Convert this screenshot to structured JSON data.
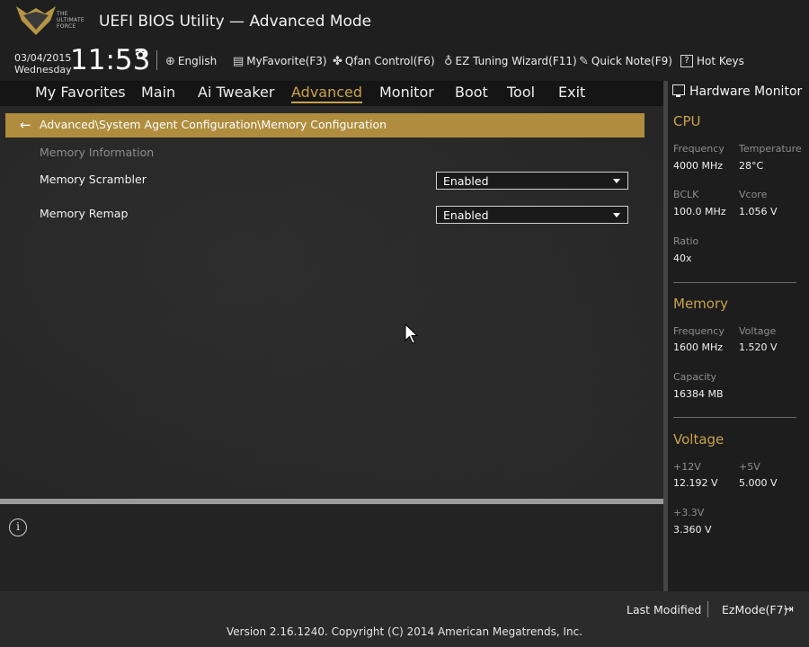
{
  "header": {
    "logo_text": "THE ULTIMATE FORCE",
    "title": "UEFI BIOS Utility — Advanced Mode",
    "date": "03/04/2015",
    "weekday": "Wednesday",
    "time": "11:53",
    "toolbar": [
      {
        "label": "English",
        "icon": "globe-icon"
      },
      {
        "label": "MyFavorite(F3)",
        "icon": "favorite-icon"
      },
      {
        "label": "Qfan Control(F6)",
        "icon": "fan-icon"
      },
      {
        "label": "EZ Tuning Wizard(F11)",
        "icon": "lightbulb-icon"
      },
      {
        "label": "Quick Note(F9)",
        "icon": "note-icon"
      },
      {
        "label": "Hot Keys",
        "icon": "question-icon"
      }
    ]
  },
  "nav": {
    "items": [
      "My Favorites",
      "Main",
      "Ai Tweaker",
      "Advanced",
      "Monitor",
      "Boot",
      "Tool",
      "Exit"
    ],
    "active": "Advanced"
  },
  "breadcrumb": "Advanced\\System Agent Configuration\\Memory Configuration",
  "main": {
    "section_label": "Memory Information",
    "rows": [
      {
        "label": "Memory Scrambler",
        "value": "Enabled"
      },
      {
        "label": "Memory Remap",
        "value": "Enabled"
      }
    ]
  },
  "hardware_monitor": {
    "title": "Hardware Monitor",
    "cpu": {
      "heading": "CPU",
      "frequency_label": "Frequency",
      "frequency": "4000 MHz",
      "temperature_label": "Temperature",
      "temperature": "28°C",
      "bclk_label": "BCLK",
      "bclk": "100.0 MHz",
      "vcore_label": "Vcore",
      "vcore": "1.056 V",
      "ratio_label": "Ratio",
      "ratio": "40x"
    },
    "memory": {
      "heading": "Memory",
      "frequency_label": "Frequency",
      "frequency": "1600 MHz",
      "voltage_label": "Voltage",
      "voltage": "1.520 V",
      "capacity_label": "Capacity",
      "capacity": "16384 MB"
    },
    "voltage": {
      "heading": "Voltage",
      "v12_label": "+12V",
      "v12": "12.192 V",
      "v5_label": "+5V",
      "v5": "5.000 V",
      "v33_label": "+3.3V",
      "v33": "3.360 V"
    }
  },
  "footer": {
    "last_modified": "Last Modified",
    "ezmode": "EzMode(F7)",
    "version": "Version 2.16.1240. Copyright (C) 2014 American Megatrends, Inc."
  },
  "colors": {
    "accent": "#c8a24a",
    "breadcrumb_bg": "#b08d3e"
  }
}
